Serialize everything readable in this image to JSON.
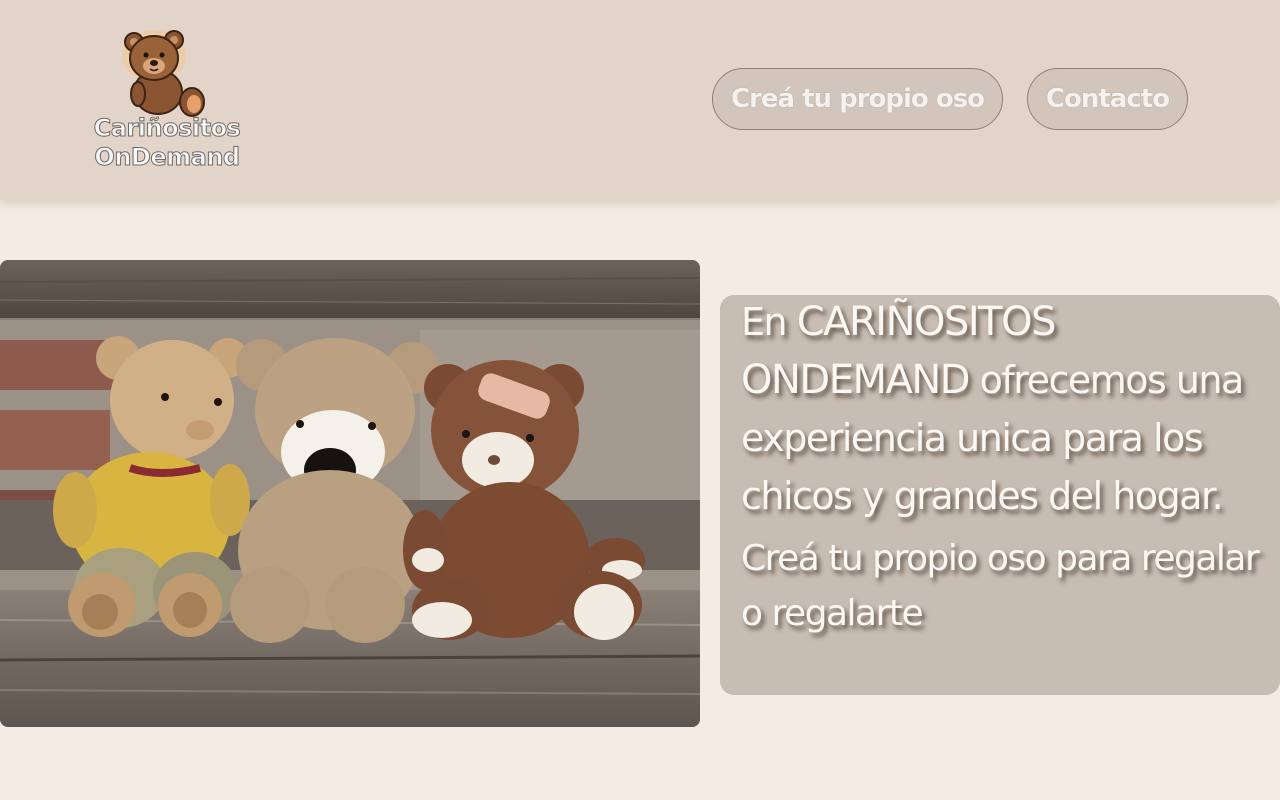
{
  "header": {
    "logo": {
      "line1": "Cariñositos",
      "line2": "OnDemand"
    },
    "nav": [
      {
        "label": "Creá tu propio oso"
      },
      {
        "label": "Contacto"
      }
    ]
  },
  "hero": {
    "image_alt": "Tres ositos de peluche sentados en un banco de madera",
    "intro_prefix": "En",
    "brand": "CARIÑOSITOS ONDEMAND",
    "intro_rest": "ofrecemos una experiencia unica para los chicos y grandes del hogar.",
    "cta_text": "Creá tu propio oso para regalar o regalarte"
  },
  "colors": {
    "header_bg": "#e2d4c8",
    "page_bg": "#f5ebe2",
    "info_box_bg": "#c8bdb2",
    "text_light": "#fbf8f4"
  }
}
